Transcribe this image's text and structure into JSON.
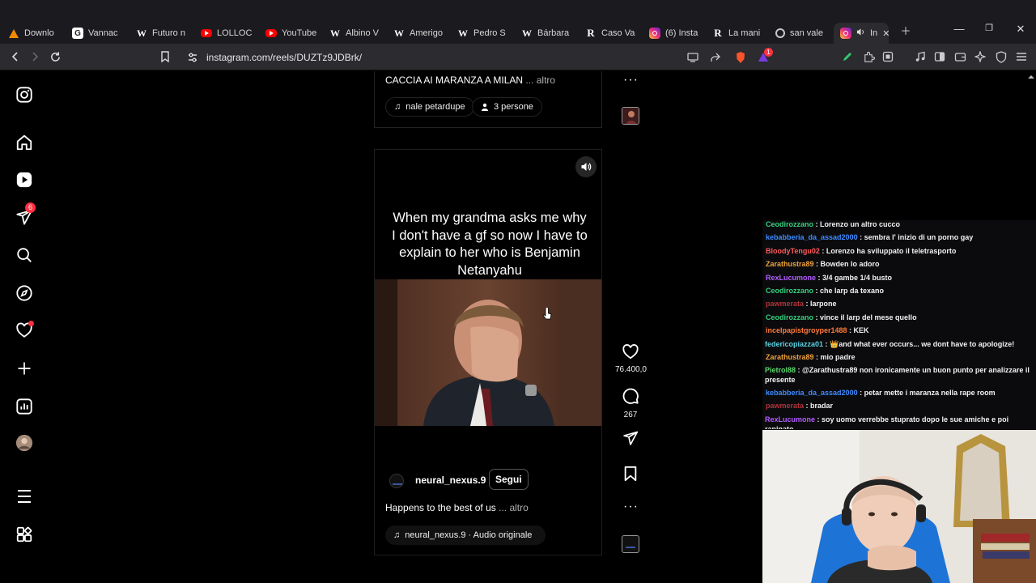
{
  "browser": {
    "tabs": [
      {
        "label": "Downlo",
        "icon": "vlc-icon",
        "color": "#f08a00"
      },
      {
        "label": "Vannac",
        "icon": "g-icon",
        "color": "#ffffff"
      },
      {
        "label": "Futuro n",
        "icon": "wikipedia-icon",
        "color": "#ffffff"
      },
      {
        "label": "LOLLOC",
        "icon": "youtube-icon",
        "color": "#ff0000"
      },
      {
        "label": "YouTube",
        "icon": "youtube-icon",
        "color": "#ff0000"
      },
      {
        "label": "Albino V",
        "icon": "wikipedia-icon",
        "color": "#ffffff"
      },
      {
        "label": "Amerigo",
        "icon": "wikipedia-icon",
        "color": "#ffffff"
      },
      {
        "label": "Pedro S",
        "icon": "wikipedia-icon",
        "color": "#ffffff"
      },
      {
        "label": "Bárbara",
        "icon": "wikipedia-icon",
        "color": "#ffffff"
      },
      {
        "label": "Caso Va",
        "icon": "r-icon",
        "color": "#ffffff"
      },
      {
        "label": "(6) Insta",
        "icon": "instagram-icon",
        "color": "#e1306c"
      },
      {
        "label": "La mani",
        "icon": "r-icon",
        "color": "#ffffff"
      },
      {
        "label": "san vale",
        "icon": "brave-search-icon",
        "color": "#c8c8c8"
      },
      {
        "label": "In",
        "icon": "instagram-icon",
        "color": "#e1306c"
      }
    ],
    "url": "instagram.com/reels/DUZTz9JDBrk/",
    "extension_badge": "1"
  },
  "instagram": {
    "notification_count": "6",
    "top_reel": {
      "caption": "CACCIA AI MARANZA A MILAN ",
      "more": "... altro",
      "audio_label": "nale  petardupe",
      "people_label": "3 persone"
    },
    "reel": {
      "overlay_text": "When my grandma asks me why I don't have a gf so now I have to explain to her who is Benjamin Netanyahu",
      "username": "neural_nexus.9",
      "follow_label": "Segui",
      "caption": "Happens to the best of us",
      "more": "... altro",
      "audio_label": "neural_nexus.9 · Audio originale",
      "likes": "76.400,0",
      "comments": "267"
    }
  },
  "chat": {
    "messages": [
      {
        "user": "Ceodirozzano",
        "color": "#36d07a",
        "text": "Lorenzo un altro cucco"
      },
      {
        "user": "kebabberia_da_assad2000",
        "color": "#3d8bff",
        "text": "sembra l' inizio di un porno gay"
      },
      {
        "user": "BloodyTengu02",
        "color": "#ff5a5a",
        "text": "Lorenzo ha sviluppato il teletrasporto"
      },
      {
        "user": "Zarathustra89",
        "color": "#f0a23a",
        "text": "Bowden lo adoro"
      },
      {
        "user": "RexLucumone",
        "color": "#b45cff",
        "text": "3/4 gambe 1/4 busto"
      },
      {
        "user": "Ceodirozzano",
        "color": "#36d07a",
        "text": "che larp da texano"
      },
      {
        "user": "pawmerata",
        "color": "#b0343a",
        "text": "larpone"
      },
      {
        "user": "Ceodirozzano",
        "color": "#36d07a",
        "text": "vince il larp del mese quello"
      },
      {
        "user": "incelpapistgroyper1488",
        "color": "#ff7a3a",
        "text": "KEK"
      },
      {
        "user": "federicopiazza01",
        "color": "#5ad1e0",
        "text": "👑and what ever occurs... we dont have to apologize!"
      },
      {
        "user": "Zarathustra89",
        "color": "#f0a23a",
        "text": "mio padre"
      },
      {
        "user": "Pietrol88",
        "color": "#5ad86a",
        "text": "@Zarathustra89 non ironicamente un buon punto per analizzare il presente"
      },
      {
        "user": "kebabberia_da_assad2000",
        "color": "#3d8bff",
        "text": "petar mette i maranza nella rape room"
      },
      {
        "user": "pawmerata",
        "color": "#b0343a",
        "text": "bradar"
      },
      {
        "user": "RexLucumone",
        "color": "#b45cff",
        "text": "soy uomo verrebbe stuprato dopo le sue amiche e poi rapinato"
      }
    ]
  }
}
